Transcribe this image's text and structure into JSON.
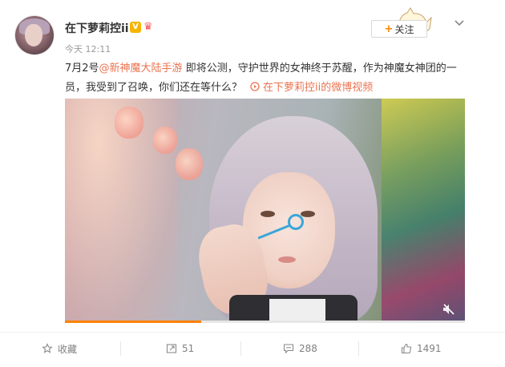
{
  "user": {
    "name": "在下萝莉控ii",
    "time": "今天 12:11"
  },
  "follow": {
    "label": "关注"
  },
  "post": {
    "text_part1": "7月2号",
    "mention": "@新神魔大陆手游",
    "text_part2": " 即将公测，守护世界的女神终于苏醒，作为神魔女神团的一员，我受到了召唤，你们还在等什么？",
    "video_link": "在下萝莉控ii的微博视频"
  },
  "video": {
    "progress_fraction": 0.34
  },
  "actions": {
    "favorite": "收藏",
    "repost": "51",
    "comment": "288",
    "like": "1491"
  },
  "colors": {
    "accent": "#ff8200",
    "link": "#eb7350",
    "v_badge": "#f7b500"
  }
}
